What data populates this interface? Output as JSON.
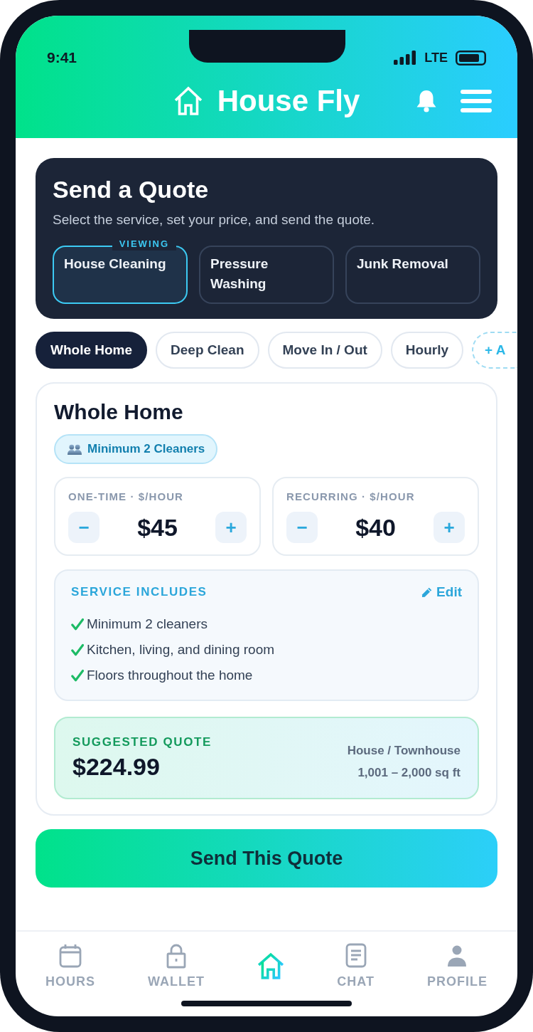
{
  "status_bar": {
    "time": "9:41",
    "network": "LTE"
  },
  "header": {
    "title": "House Fly"
  },
  "quote_panel": {
    "title": "Send a Quote",
    "subtitle": "Select the service, set your price, and send the quote.",
    "services": [
      {
        "label": "House Cleaning",
        "selected": true,
        "badge": "VIEWING"
      },
      {
        "label": "Pressure Washing",
        "selected": false
      },
      {
        "label": "Junk Removal",
        "selected": false
      }
    ]
  },
  "packages": [
    {
      "label": "Whole Home",
      "kind": "option",
      "selected": true
    },
    {
      "label": "Deep Clean",
      "kind": "option",
      "selected": false
    },
    {
      "label": "Move In / Out",
      "kind": "option",
      "selected": false
    },
    {
      "label": "Hourly",
      "kind": "option",
      "selected": false
    },
    {
      "label": "+ A",
      "kind": "add",
      "selected": false
    }
  ],
  "package_detail": {
    "title": "Whole Home",
    "badge": "Minimum 2 Cleaners",
    "prices": [
      {
        "label": "ONE-TIME · $/HOUR",
        "value": "$45",
        "decrease": "−",
        "increase": "+"
      },
      {
        "label": "RECURRING · $/HOUR",
        "value": "$40",
        "decrease": "−",
        "increase": "+"
      }
    ],
    "includes": {
      "title": "SERVICE INCLUDES",
      "edit": "Edit",
      "items": [
        "Minimum 2 cleaners",
        "Kitchen, living, and dining room",
        "Floors throughout the home"
      ]
    },
    "suggested": {
      "label": "SUGGESTED QUOTE",
      "amount": "$224.99",
      "property_type": "House / Townhouse",
      "size_range": "1,001 – 2,000 sq ft"
    }
  },
  "send_button": "Send This Quote",
  "bottom_nav": [
    {
      "label": "HOURS",
      "selected": false
    },
    {
      "label": "WALLET",
      "selected": false
    },
    {
      "selected": true
    },
    {
      "label": "CHAT",
      "selected": false
    },
    {
      "label": "PROFILE",
      "selected": false
    }
  ]
}
